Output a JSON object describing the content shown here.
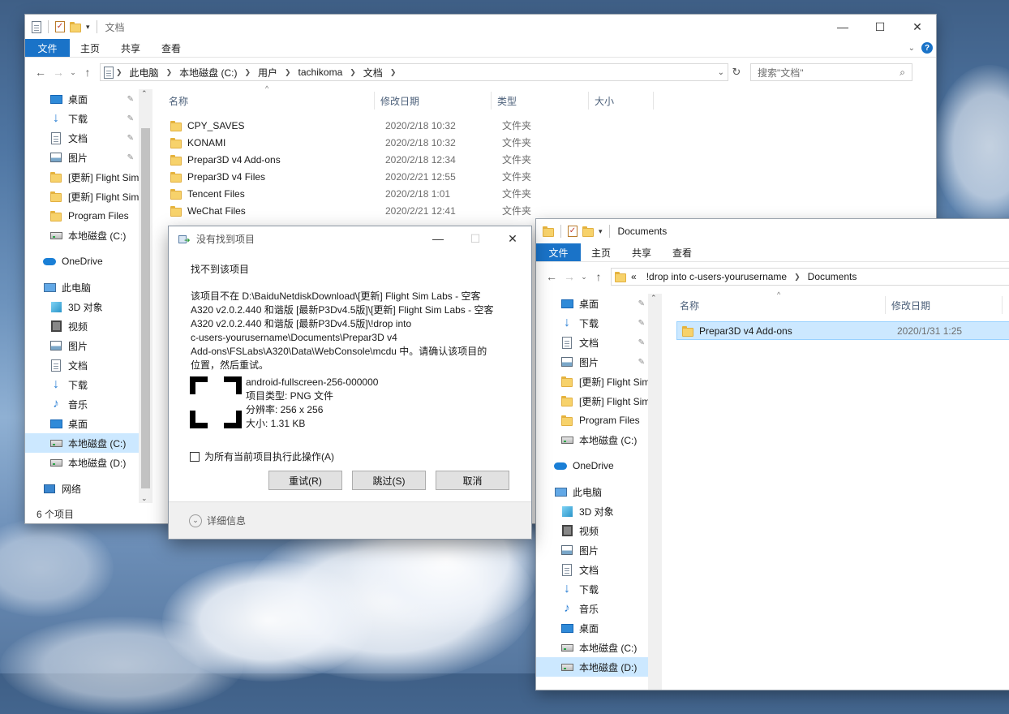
{
  "win1": {
    "title": "文档",
    "tabs": {
      "file": "文件",
      "home": "主页",
      "share": "共享",
      "view": "查看"
    },
    "breadcrumb": [
      "此电脑",
      "本地磁盘 (C:)",
      "用户",
      "tachikoma",
      "文档"
    ],
    "search_placeholder": "搜索\"文档\"",
    "nav": [
      {
        "label": "桌面",
        "icon": "desktop-icon",
        "pinned": true
      },
      {
        "label": "下载",
        "icon": "download-icon",
        "pinned": true
      },
      {
        "label": "文档",
        "icon": "document-icon",
        "pinned": true
      },
      {
        "label": "图片",
        "icon": "picture-icon",
        "pinned": true
      },
      {
        "label": "[更新] Flight Sim",
        "icon": "folder-icon"
      },
      {
        "label": "[更新] Flight Sim",
        "icon": "folder-icon"
      },
      {
        "label": "Program Files",
        "icon": "folder-icon"
      },
      {
        "label": "本地磁盘 (C:)",
        "icon": "drive-icon"
      },
      {
        "label": "OneDrive",
        "icon": "onedrive-icon"
      },
      {
        "label": "此电脑",
        "icon": "pc-icon"
      },
      {
        "label": "3D 对象",
        "icon": "3d-objects-icon"
      },
      {
        "label": "视频",
        "icon": "video-icon"
      },
      {
        "label": "图片",
        "icon": "picture-icon"
      },
      {
        "label": "文档",
        "icon": "document-icon"
      },
      {
        "label": "下载",
        "icon": "download-icon"
      },
      {
        "label": "音乐",
        "icon": "music-icon"
      },
      {
        "label": "桌面",
        "icon": "desktop-icon"
      },
      {
        "label": "本地磁盘 (C:)",
        "icon": "drive-icon",
        "selected": true
      },
      {
        "label": "本地磁盘 (D:)",
        "icon": "drive-icon"
      },
      {
        "label": "网络",
        "icon": "network-icon"
      }
    ],
    "columns": {
      "name": "名称",
      "modified": "修改日期",
      "type": "类型",
      "size": "大小"
    },
    "files": [
      {
        "name": "CPY_SAVES",
        "modified": "2020/2/18 10:32",
        "type": "文件夹"
      },
      {
        "name": "KONAMI",
        "modified": "2020/2/18 10:32",
        "type": "文件夹"
      },
      {
        "name": "Prepar3D v4 Add-ons",
        "modified": "2020/2/18 12:34",
        "type": "文件夹"
      },
      {
        "name": "Prepar3D v4 Files",
        "modified": "2020/2/21 12:55",
        "type": "文件夹"
      },
      {
        "name": "Tencent Files",
        "modified": "2020/2/18 1:01",
        "type": "文件夹"
      },
      {
        "name": "WeChat Files",
        "modified": "2020/2/21 12:41",
        "type": "文件夹"
      }
    ],
    "status": "6 个项目"
  },
  "win2": {
    "title": "Documents",
    "tabs": {
      "file": "文件",
      "home": "主页",
      "share": "共享",
      "view": "查看"
    },
    "breadcrumb_overflow": "«",
    "breadcrumb": [
      "!drop into c-users-yourusername",
      "Documents"
    ],
    "nav": [
      {
        "label": "桌面",
        "icon": "desktop-icon",
        "pinned": true
      },
      {
        "label": "下载",
        "icon": "download-icon",
        "pinned": true
      },
      {
        "label": "文档",
        "icon": "document-icon",
        "pinned": true
      },
      {
        "label": "图片",
        "icon": "picture-icon",
        "pinned": true
      },
      {
        "label": "[更新] Flight Sim",
        "icon": "folder-icon"
      },
      {
        "label": "[更新] Flight Sim",
        "icon": "folder-icon"
      },
      {
        "label": "Program Files",
        "icon": "folder-icon"
      },
      {
        "label": "本地磁盘 (C:)",
        "icon": "drive-icon"
      },
      {
        "label": "OneDrive",
        "icon": "onedrive-icon"
      },
      {
        "label": "此电脑",
        "icon": "pc-icon"
      },
      {
        "label": "3D 对象",
        "icon": "3d-objects-icon"
      },
      {
        "label": "视频",
        "icon": "video-icon"
      },
      {
        "label": "图片",
        "icon": "picture-icon"
      },
      {
        "label": "文档",
        "icon": "document-icon"
      },
      {
        "label": "下载",
        "icon": "download-icon"
      },
      {
        "label": "音乐",
        "icon": "music-icon"
      },
      {
        "label": "桌面",
        "icon": "desktop-icon"
      },
      {
        "label": "本地磁盘 (C:)",
        "icon": "drive-icon"
      },
      {
        "label": "本地磁盘 (D:)",
        "icon": "drive-icon",
        "selected": true
      }
    ],
    "columns": {
      "name": "名称",
      "modified": "修改日期"
    },
    "files": [
      {
        "name": "Prepar3D v4 Add-ons",
        "modified": "2020/1/31 1:25",
        "selected": true
      }
    ]
  },
  "dialog": {
    "title": "没有找到项目",
    "heading": "找不到该项目",
    "message_lines": [
      "该项目不在 D:\\BaiduNetdiskDownload\\[更新] Flight Sim Labs - 空客",
      "A320 v2.0.2.440 和谐版 [最新P3Dv4.5版]\\[更新] Flight Sim Labs - 空客",
      "A320 v2.0.2.440 和谐版 [最新P3Dv4.5版]\\!drop into",
      "c-users-yourusername\\Documents\\Prepar3D v4",
      "Add-ons\\FSLabs\\A320\\Data\\WebConsole\\mcdu 中。请确认该项目的",
      "位置，然后重试。"
    ],
    "file_name": "android-fullscreen-256-000000",
    "file_type": "项目类型: PNG 文件",
    "resolution": "分辨率: 256 x 256",
    "size": "大小: 1.31 KB",
    "checkbox_label": "为所有当前项目执行此操作(A)",
    "buttons": {
      "retry": "重试(R)",
      "skip": "跳过(S)",
      "cancel": "取消"
    },
    "details": "详细信息"
  }
}
